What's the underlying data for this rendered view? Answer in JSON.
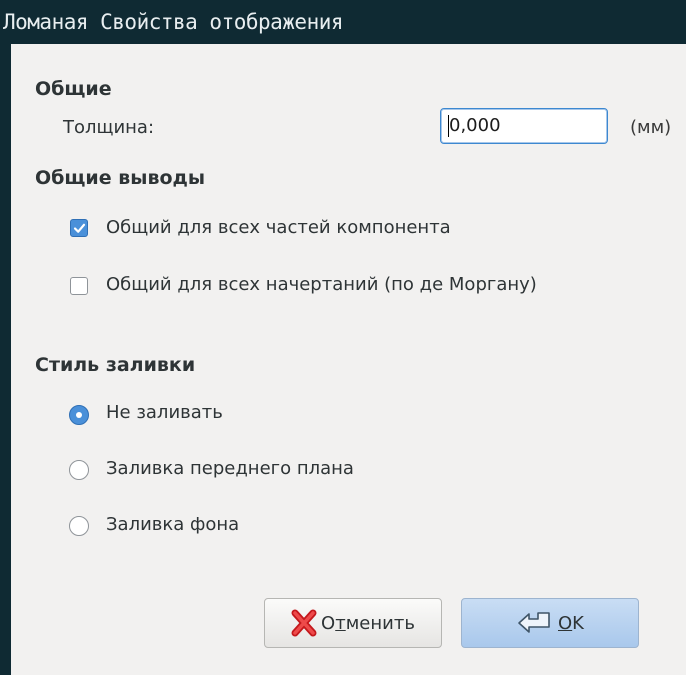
{
  "window": {
    "title": "Ломаная Свойства отображения"
  },
  "general": {
    "heading": "Общие",
    "thickness_label": "Толщина:",
    "thickness_value": "0,000",
    "unit": "(мм)"
  },
  "common_pins": {
    "heading": "Общие выводы",
    "options": [
      {
        "label": "Общий для всех частей компонента",
        "checked": true
      },
      {
        "label": "Общий для всех начертаний (по де Моргану)",
        "checked": false
      }
    ]
  },
  "fill_style": {
    "heading": "Стиль заливки",
    "options": [
      {
        "label": "Не заливать",
        "selected": true
      },
      {
        "label": "Заливка переднего плана",
        "selected": false
      },
      {
        "label": "Заливка фона",
        "selected": false
      }
    ]
  },
  "buttons": {
    "cancel_prefix": "О",
    "cancel_mnemonic": "т",
    "cancel_rest": "менить",
    "ok_mnemonic": "O",
    "ok_rest": "K"
  },
  "colors": {
    "titlebar_bg": "#0f2a33",
    "accent": "#4a90d9",
    "dialog_bg": "#f2f1f0"
  },
  "icons": {
    "cancel": "red-x-icon",
    "ok": "enter-arrow-icon",
    "checked": "checkmark-icon"
  }
}
